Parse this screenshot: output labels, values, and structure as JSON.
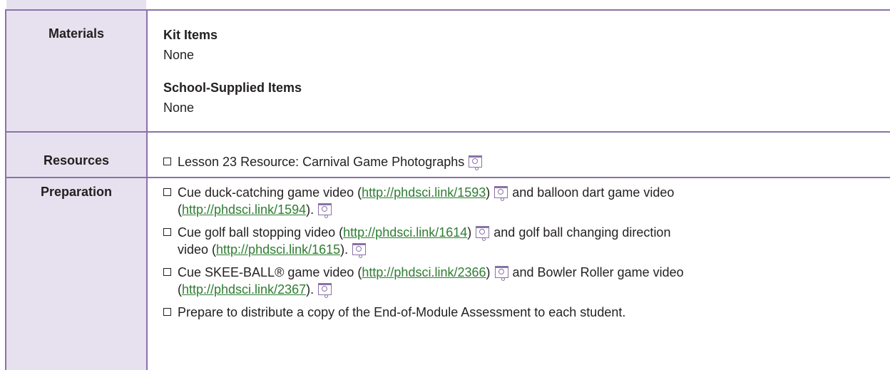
{
  "materials": {
    "label": "Materials",
    "kit_heading": "Kit Items",
    "kit_value": "None",
    "school_heading": "School-Supplied Items",
    "school_value": "None"
  },
  "resources": {
    "label": "Resources",
    "item1": "Lesson 23 Resource: Carnival Game Photographs",
    "icon": "presentation-icon"
  },
  "preparation": {
    "label": "Preparation",
    "item1": {
      "t1": "Cue duck-catching game video (",
      "link1": "http://phdsci.link/1593",
      "t2": ")",
      "t3": "and balloon dart game video",
      "t4": "(",
      "link2": "http://phdsci.link/1594",
      "t5": ")."
    },
    "item2": {
      "t1": "Cue golf ball stopping video (",
      "link1": "http://phdsci.link/1614",
      "t2": ")",
      "t3": "and golf ball changing direction",
      "t4": "video (",
      "link2": "http://phdsci.link/1615",
      "t5": ")."
    },
    "item3": {
      "t1": "Cue SKEE-BALL® game video (",
      "link1": "http://phdsci.link/2366",
      "t2": ")",
      "t3": "and Bowler Roller game video",
      "t4": "(",
      "link2": "http://phdsci.link/2367",
      "t5": ")."
    },
    "item4": "Prepare to distribute a copy of the End-of-Module Assessment to each student."
  },
  "colors": {
    "border": "#8a72a8",
    "label_background": "#e7e1ef",
    "link": "#2e7d32"
  }
}
